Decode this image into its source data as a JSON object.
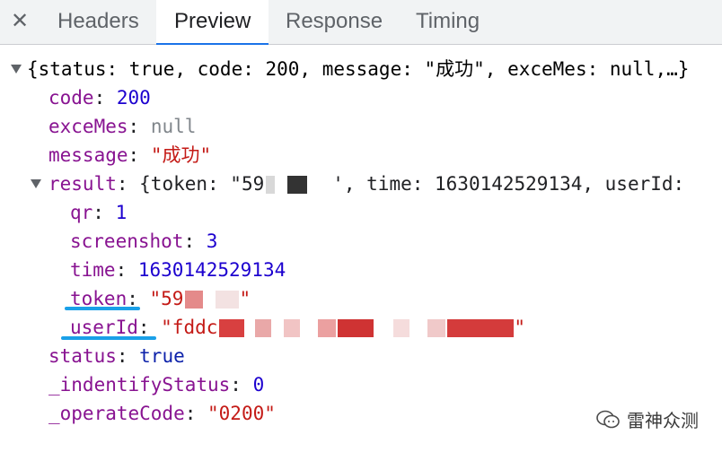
{
  "tabs": {
    "close_glyph": "✕",
    "items": [
      "Headers",
      "Preview",
      "Response",
      "Timing"
    ]
  },
  "preview": {
    "summary": "{status: true, code: 200, message: \"成功\", exceMes: null,…}",
    "code": {
      "key": "code",
      "value": "200"
    },
    "exceMes": {
      "key": "exceMes",
      "value": "null"
    },
    "message": {
      "key": "message",
      "value": "\"成功\""
    },
    "result": {
      "key": "result",
      "summary_pre": "{token: \"59",
      "summary_post": "', time: 1630142529134, userId:",
      "qr": {
        "key": "qr",
        "value": "1"
      },
      "screenshot": {
        "key": "screenshot",
        "value": "3"
      },
      "time": {
        "key": "time",
        "value": "1630142529134"
      },
      "token": {
        "key": "token",
        "value_pre": "\"59",
        "value_post": "\""
      },
      "userId": {
        "key": "userId",
        "value_pre": "\"fddc",
        "value_post": "\""
      }
    },
    "status": {
      "key": "status",
      "value": "true"
    },
    "identifyStatus": {
      "key": "_indentifyStatus",
      "value": "0"
    },
    "operateCode": {
      "key": "_operateCode",
      "value": "\"0200\""
    }
  },
  "watermark": {
    "text": "雷神众测"
  },
  "colors": {
    "underline": "#1aa0e8",
    "redaction": "#e25b5b"
  }
}
